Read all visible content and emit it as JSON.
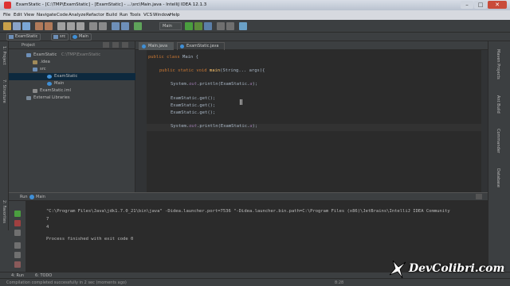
{
  "window": {
    "title": "ExamStatic - [C:\\TMP\\ExamStatic] - [ExamStatic] - ...\\src\\Main.java - IntelliJ IDEA 12.1.3"
  },
  "menu": [
    "File",
    "Edit",
    "View",
    "Navigate",
    "Code",
    "Analyze",
    "Refactor",
    "Build",
    "Run",
    "Tools",
    "VCS",
    "Window",
    "Help"
  ],
  "toolbar": {
    "run_config": "Main"
  },
  "breadcrumbs": [
    "ExamStatic",
    "src",
    "Main"
  ],
  "left_strip": {
    "project_label": "1: Project",
    "structure_label": "7: Structure",
    "favorites_label": "2: Favorites"
  },
  "right_strip": {
    "maven_label": "Maven Projects",
    "ant_build_label": "Ant Build",
    "commander_label": "Commander",
    "database_label": "Database"
  },
  "project_panel": {
    "header": "Project",
    "tree": [
      {
        "label": "ExamStatic",
        "extra": "C:\\TMP\\ExamStatic"
      },
      {
        "label": ".idea"
      },
      {
        "label": "src"
      },
      {
        "label": "ExamStatic"
      },
      {
        "label": "Main"
      },
      {
        "label": "ExamStatic.iml"
      },
      {
        "label": "External Libraries"
      }
    ]
  },
  "editor": {
    "tabs": [
      "Main.java",
      "ExamStatic.java"
    ],
    "lines": {
      "l1_kw": "public class",
      "l1_rest": " Main {",
      "l2_kw": "public static void",
      "l2_fn": " main",
      "l2_rest": "(String... args){",
      "l3_a": "System.",
      "l3_out": "out",
      "l3_b": ".println(ExamStatic.",
      "l3_c": "a",
      "l3_d": ");",
      "l4": "ExamStatic.get();",
      "l5": "ExamStatic.get();",
      "l6": "ExamStatic.get();",
      "l7_a": "System.",
      "l7_out": "out",
      "l7_b": ".println(ExamStatic.",
      "l7_c": "a",
      "l7_d": ");"
    }
  },
  "run_panel": {
    "header_run": "Run",
    "header_tab": "Main",
    "output": [
      "\"C:\\Program Files\\Java\\jdk1.7.0_21\\bin\\java\" -Didea.launcher.port=7536 \"-Didea.launcher.bin.path=C:\\Program Files (x86)\\JetBrains\\IntelliJ IDEA Community",
      "7",
      "4",
      "",
      "Process finished with exit code 0"
    ]
  },
  "bottom_tabs": {
    "run": "4: Run",
    "todo": "6: TODO"
  },
  "status": {
    "text": "Compilation completed successfully in 2 sec (moments ago)",
    "position": "8:28"
  },
  "watermark": {
    "text": "DevColibri.com"
  },
  "colors": {
    "accent_run": "#4a9e3f",
    "selection": "#0d293e",
    "keyword": "#cc7832"
  }
}
